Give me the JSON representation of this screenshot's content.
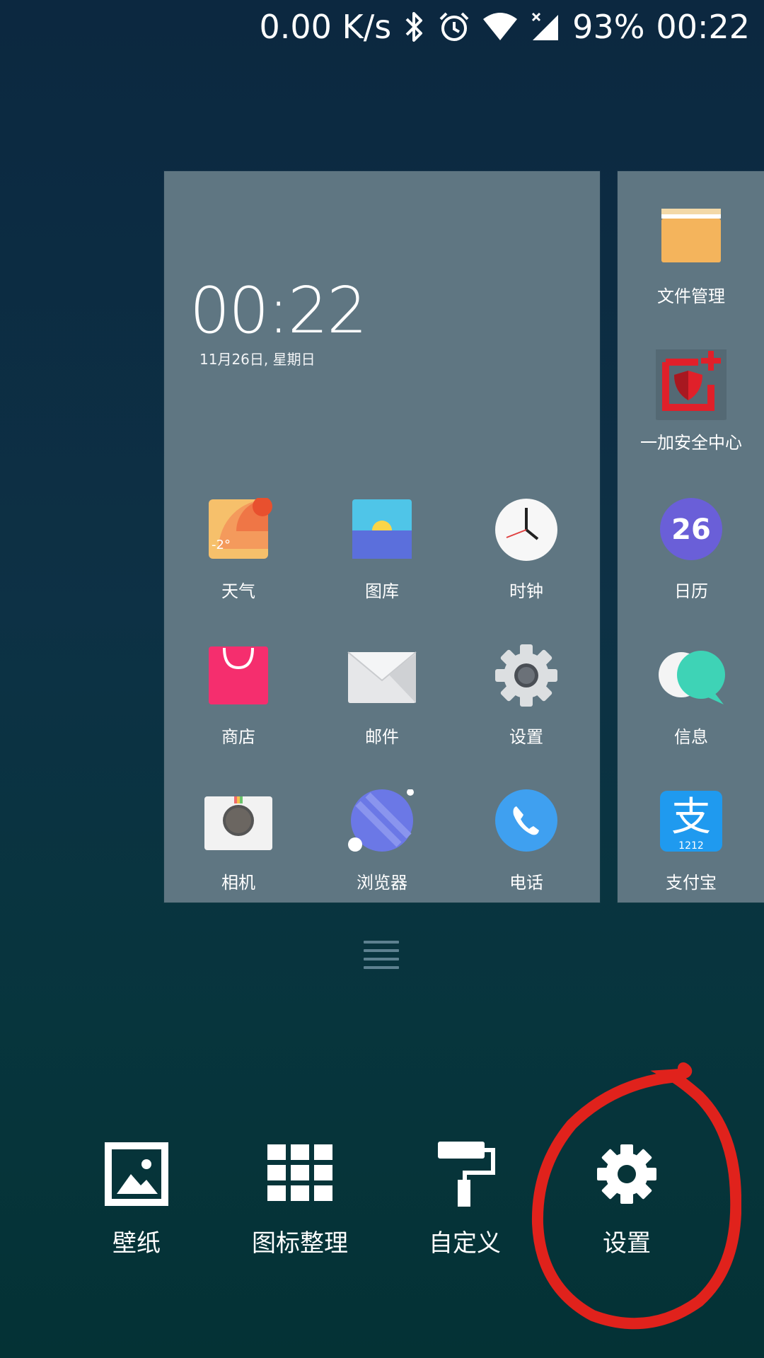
{
  "status_bar": {
    "net_speed": "0.00 K/s",
    "battery": "93%",
    "time": "00:22",
    "icons": [
      "bluetooth-icon",
      "alarm-icon",
      "wifi-icon",
      "signal-icon"
    ]
  },
  "preview": {
    "clock_time": "00:22",
    "clock_date": "11月26日, 星期日",
    "main_apps": [
      {
        "label": "天气",
        "icon": "weather-icon",
        "badge": "-2°"
      },
      {
        "label": "图库",
        "icon": "gallery-icon"
      },
      {
        "label": "时钟",
        "icon": "clock-icon"
      },
      {
        "label": "商店",
        "icon": "store-icon"
      },
      {
        "label": "邮件",
        "icon": "mail-icon"
      },
      {
        "label": "设置",
        "icon": "settings-icon"
      },
      {
        "label": "相机",
        "icon": "camera-icon"
      },
      {
        "label": "浏览器",
        "icon": "browser-icon"
      },
      {
        "label": "电话",
        "icon": "phone-icon"
      }
    ],
    "side_apps": [
      {
        "label": "文件管理",
        "icon": "folder-icon"
      },
      {
        "label": "一加安全中心",
        "icon": "security-center-icon"
      },
      {
        "label": "日历",
        "icon": "calendar-icon",
        "badge": "26"
      },
      {
        "label": "信息",
        "icon": "messages-icon"
      },
      {
        "label": "支付宝",
        "icon": "alipay-icon",
        "badge": "1212"
      }
    ]
  },
  "toolbar": {
    "wallpaper": "壁纸",
    "icon_arrange": "图标整理",
    "customize": "自定义",
    "settings": "设置"
  },
  "colors": {
    "card": "#5f7682",
    "annotation": "#e0221c"
  }
}
